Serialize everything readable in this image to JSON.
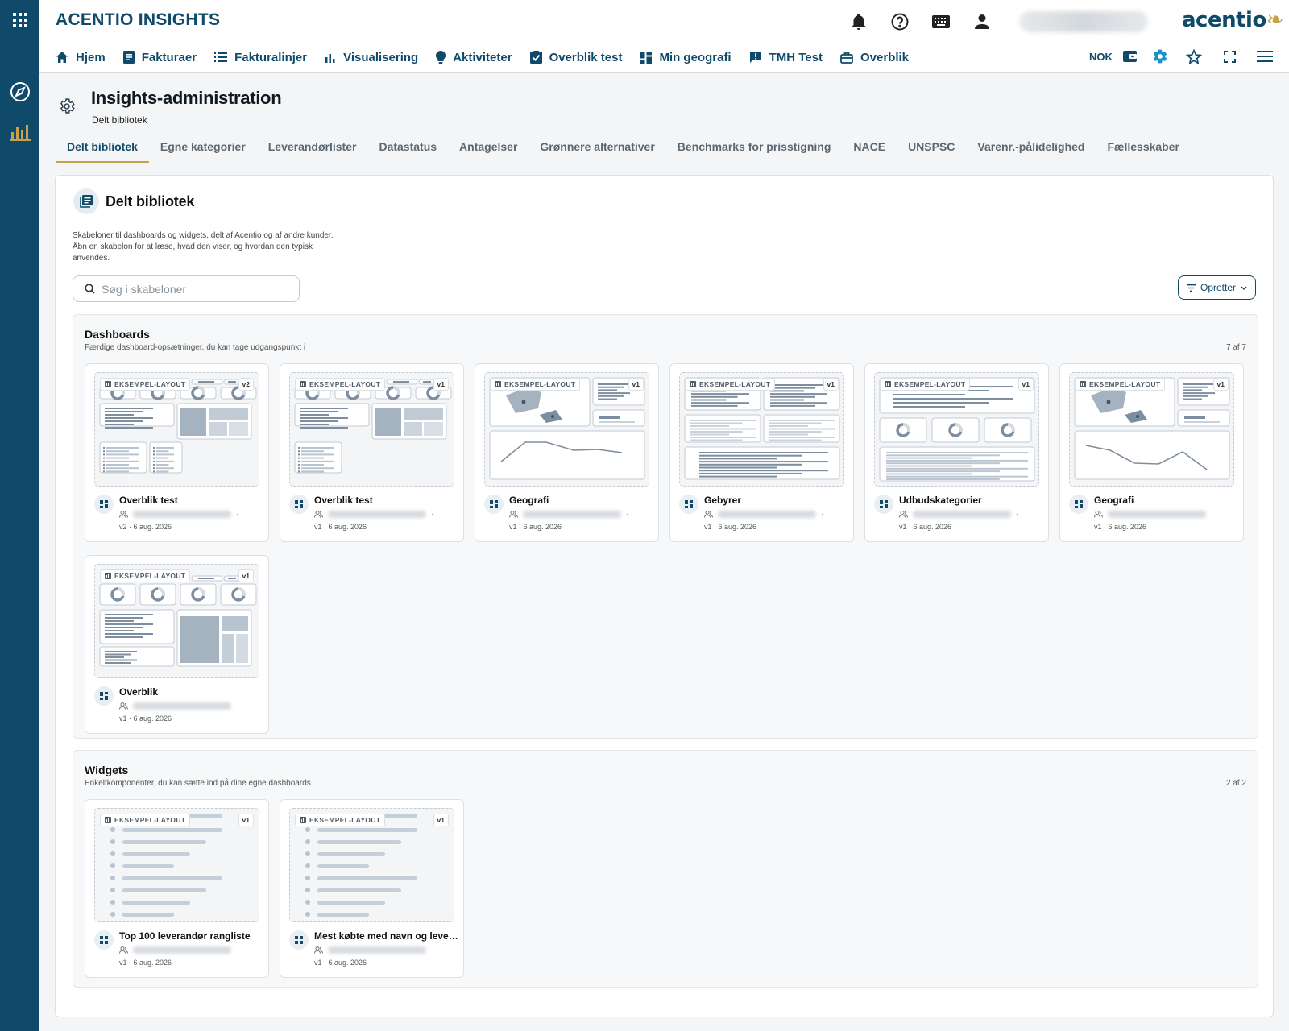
{
  "app": {
    "title": "ACENTIO INSIGHTS",
    "logo_text": "acentio",
    "currency": "NOK",
    "accent": "#0f4a6a",
    "highlight": "#c9a14a"
  },
  "nav": [
    {
      "label": "Hjem",
      "icon": "home-icon"
    },
    {
      "label": "Fakturaer",
      "icon": "invoice-icon"
    },
    {
      "label": "Fakturalinjer",
      "icon": "list-icon"
    },
    {
      "label": "Visualisering",
      "icon": "bar-chart-icon"
    },
    {
      "label": "Aktiviteter",
      "icon": "lightbulb-icon"
    },
    {
      "label": "Overblik test",
      "icon": "checkbox-icon"
    },
    {
      "label": "Min geografi",
      "icon": "dashboard-icon"
    },
    {
      "label": "TMH Test",
      "icon": "feedback-icon"
    },
    {
      "label": "Overblik",
      "icon": "briefcase-icon"
    }
  ],
  "page": {
    "title": "Insights-administration",
    "subtitle": "Delt bibliotek"
  },
  "tabs": [
    "Delt bibliotek",
    "Egne kategorier",
    "Leverandørlister",
    "Datastatus",
    "Antagelser",
    "Grønnere alternativer",
    "Benchmarks for prisstigning",
    "NACE",
    "UNSPSC",
    "Varenr.-pålidelighed",
    "Fællesskaber"
  ],
  "library": {
    "title": "Delt bibliotek",
    "description": "Skabeloner til dashboards og widgets, delt af Acentio og af andre kunder. Åbn en skabelon for at læse, hvad den viser, og hvordan den typisk anvendes.",
    "search_placeholder": "Søg i skabeloner",
    "filter_label": "Opretter",
    "badge": "EKSEMPEL-LAYOUT"
  },
  "dashboards": {
    "title": "Dashboards",
    "subtitle": "Færdige dashboard-opsætninger, du kan tage udgangspunkt i",
    "count": "7 af 7",
    "items": [
      {
        "name": "Overblik test",
        "version": "v2",
        "meta": "v2 · 6 aug. 2026",
        "layout": "A"
      },
      {
        "name": "Overblik test",
        "version": "v1",
        "meta": "v1 · 6 aug. 2026",
        "layout": "B"
      },
      {
        "name": "Geografi",
        "version": "v1",
        "meta": "v1 · 6 aug. 2026",
        "layout": "C"
      },
      {
        "name": "Gebyrer",
        "version": "v1",
        "meta": "v1 · 6 aug. 2026",
        "layout": "D"
      },
      {
        "name": "Udbudskategorier",
        "version": "v1",
        "meta": "v1 · 6 aug. 2026",
        "layout": "E"
      },
      {
        "name": "Geografi",
        "version": "v1",
        "meta": "v1 · 6 aug. 2026",
        "layout": "F"
      },
      {
        "name": "Overblik",
        "version": "v1",
        "meta": "v1 · 6 aug. 2026",
        "layout": "G"
      }
    ]
  },
  "widgets": {
    "title": "Widgets",
    "subtitle": "Enkeltkomponenter, du kan sætte ind på dine egne dashboards",
    "count": "2 af 2",
    "items": [
      {
        "name": "Top 100 leverandør rangliste",
        "version": "v1",
        "meta": "v1 · 6 aug. 2026",
        "layout": "L"
      },
      {
        "name": "Mest købte med navn og levera...",
        "version": "v1",
        "meta": "v1 · 6 aug. 2026",
        "layout": "L"
      }
    ]
  }
}
